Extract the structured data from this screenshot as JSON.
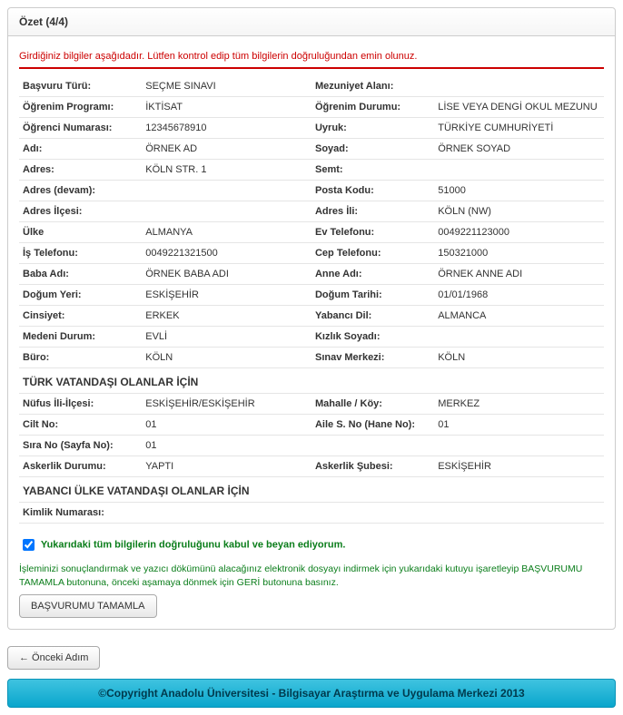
{
  "panel": {
    "header": "Özet (4/4)"
  },
  "warning": "Girdiğiniz bilgiler aşağıdadır. Lütfen kontrol edip tüm bilgilerin doğruluğundan emin olunuz.",
  "rows": [
    {
      "l1": "Başvuru Türü:",
      "v1": "SEÇME SINAVI",
      "l2": "Mezuniyet Alanı:",
      "v2": ""
    },
    {
      "l1": "Öğrenim Programı:",
      "v1": "İKTİSAT",
      "l2": "Öğrenim Durumu:",
      "v2": "LİSE VEYA DENGİ OKUL MEZUNU"
    },
    {
      "l1": "Öğrenci Numarası:",
      "v1": "12345678910",
      "l2": "Uyruk:",
      "v2": "TÜRKİYE CUMHURİYETİ"
    },
    {
      "l1": "Adı:",
      "v1": "ÖRNEK AD",
      "l2": "Soyad:",
      "v2": "ÖRNEK SOYAD"
    },
    {
      "l1": "Adres:",
      "v1": "KÖLN STR. 1",
      "l2": "Semt:",
      "v2": ""
    },
    {
      "l1": "Adres (devam):",
      "v1": "",
      "l2": "Posta Kodu:",
      "v2": "51000"
    },
    {
      "l1": "Adres İlçesi:",
      "v1": "",
      "l2": "Adres İli:",
      "v2": "KÖLN (NW)"
    },
    {
      "l1": "Ülke",
      "v1": "ALMANYA",
      "l2": "Ev Telefonu:",
      "v2": "0049221123000"
    },
    {
      "l1": "İş Telefonu:",
      "v1": "0049221321500",
      "l2": "Cep Telefonu:",
      "v2": "150321000"
    },
    {
      "l1": "Baba Adı:",
      "v1": "ÖRNEK BABA ADI",
      "l2": "Anne Adı:",
      "v2": "ÖRNEK ANNE ADI"
    },
    {
      "l1": "Doğum Yeri:",
      "v1": "ESKİŞEHİR",
      "l2": "Doğum Tarihi:",
      "v2": "01/01/1968"
    },
    {
      "l1": "Cinsiyet:",
      "v1": "ERKEK",
      "l2": "Yabancı Dil:",
      "v2": "ALMANCA"
    },
    {
      "l1": "Medeni Durum:",
      "v1": "EVLİ",
      "l2": "Kızlık Soyadı:",
      "v2": ""
    },
    {
      "l1": "Büro:",
      "v1": "KÖLN",
      "l2": "Sınav Merkezi:",
      "v2": "KÖLN"
    }
  ],
  "section1": "TÜRK VATANDAŞI OLANLAR İÇİN",
  "rows2": [
    {
      "l1": "Nüfus İli-İlçesi:",
      "v1": "ESKİŞEHİR/ESKİŞEHİR",
      "l2": "Mahalle / Köy:",
      "v2": "MERKEZ"
    },
    {
      "l1": "Cilt No:",
      "v1": "01",
      "l2": "Aile S. No (Hane No):",
      "v2": "01"
    },
    {
      "l1": "Sıra No (Sayfa No):",
      "v1": "01",
      "l2": "",
      "v2": ""
    },
    {
      "l1": "Askerlik Durumu:",
      "v1": "YAPTI",
      "l2": "Askerlik Şubesi:",
      "v2": "ESKİŞEHİR"
    }
  ],
  "section2": "YABANCI ÜLKE VATANDAŞI OLANLAR İÇİN",
  "rows3": [
    {
      "l1": "Kimlik Numarası:",
      "v1": "",
      "l2": "",
      "v2": ""
    }
  ],
  "confirm": "Yukarıdaki tüm bilgilerin doğruluğunu kabul ve beyan ediyorum.",
  "help": "İşleminizi sonuçlandırmak ve yazıcı dökümünü alacağınız elektronik dosyayı indirmek için yukarıdaki kutuyu işaretleyip BAŞVURUMU TAMAMLA butonuna, önceki aşamaya dönmek için GERİ butonuna basınız.",
  "buttons": {
    "submit": "BAŞVURUMU TAMAMLA",
    "prev": "←   Önceki Adım"
  },
  "footer": "©Copyright Anadolu Üniversitesi - Bilgisayar Araştırma ve Uygulama Merkezi 2013"
}
